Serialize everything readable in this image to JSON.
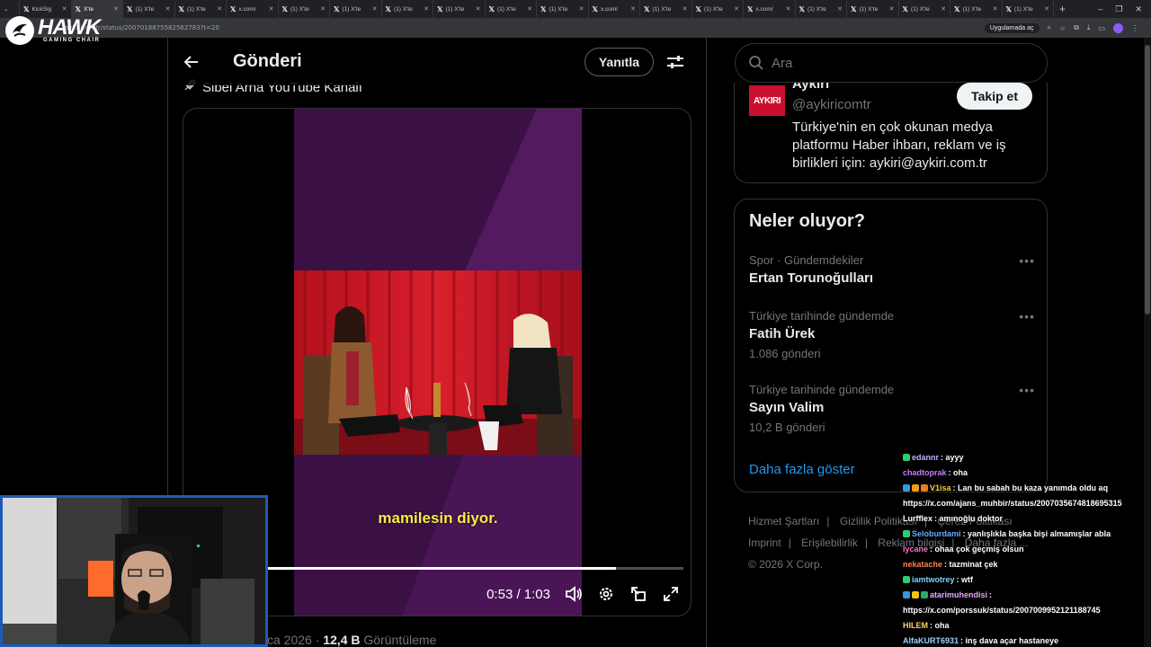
{
  "browser": {
    "tabs": [
      {
        "label": "KickSig",
        "active": false
      },
      {
        "label": "X'te",
        "active": true
      },
      {
        "label": "(1) X'te",
        "active": false
      },
      {
        "label": "(1) X'te",
        "active": false
      },
      {
        "label": "x.com/",
        "active": false
      },
      {
        "label": "(1) X'te",
        "active": false
      },
      {
        "label": "(1) X'te",
        "active": false
      },
      {
        "label": "(1) X'te",
        "active": false
      },
      {
        "label": "(1) X'te",
        "active": false
      },
      {
        "label": "(1) X'te",
        "active": false
      },
      {
        "label": "(1) X'te",
        "active": false
      },
      {
        "label": "x.com/",
        "active": false
      },
      {
        "label": "(1) X'te",
        "active": false
      },
      {
        "label": "(1) X'te",
        "active": false
      },
      {
        "label": "x.com/",
        "active": false
      },
      {
        "label": "(1) X'te",
        "active": false
      },
      {
        "label": "(1) X'te",
        "active": false
      },
      {
        "label": "(1) X'te",
        "active": false
      },
      {
        "label": "(1) X'te",
        "active": false
      },
      {
        "label": "(1) X'te",
        "active": false
      }
    ],
    "url": "aykiricomtr/status/2007018875582562783?t=20",
    "open_in_app": "Uygulamada aç"
  },
  "overlay": {
    "brand_name": "HAWK",
    "brand_sub": "GAMING CHAIR"
  },
  "post": {
    "header_title": "Gönderi",
    "reply_label": "Yanıtla",
    "source_line": "Sibel Arna YouTube Kanalı",
    "video": {
      "subtitle": "mamilesin diyor.",
      "time": "0:53 / 1:03",
      "progress": 0.84
    },
    "meta_date": "ca 2026",
    "meta_views": "12,4 B",
    "meta_views_label": "Görüntüleme"
  },
  "sidebar": {
    "search_placeholder": "Ara",
    "profile": {
      "name": "Aykırı",
      "handle": "@aykiricomtr",
      "avatar_text": "AYKIRI",
      "follow_label": "Takip et",
      "bio": "Türkiye'nin en çok okunan medya platformu Haber ihbarı, reklam ve iş birlikleri için: aykiri@aykiri.com.tr"
    },
    "trends_title": "Neler oluyor?",
    "trends": [
      {
        "context": "Spor · Gündemdekiler",
        "name": "Ertan Torunoğulları",
        "count": ""
      },
      {
        "context": "Türkiye tarihinde gündemde",
        "name": "Fatih Ürek",
        "count": "1.086 gönderi"
      },
      {
        "context": "Türkiye tarihinde gündemde",
        "name": "Sayın Valim",
        "count": "10,2 B gönderi"
      }
    ],
    "show_more": "Daha fazla göster",
    "footer": {
      "terms": "Hizmet Şartları",
      "privacy": "Gizlilik Politikası",
      "cookies": "Çerez Politikası",
      "imprint": "Imprint",
      "accessibility": "Erişilebilirlik",
      "ads": "Reklam bilgisi",
      "more": "Daha fazla ...",
      "copyright": "© 2026 X Corp."
    }
  },
  "chat": [
    {
      "user": "edannr",
      "color": "#b6b6ff",
      "text": "ayyy",
      "badges": [
        "#2ecc71"
      ]
    },
    {
      "user": "chadtoprak",
      "color": "#c77dff",
      "text": "oha",
      "badges": []
    },
    {
      "user": "V1isa",
      "color": "#f7d23e",
      "text": "Lan bu sabah bu kaza yanımda oldu aq https://x.com/ajans_muhbir/status/2007035674818695315",
      "badges": [
        "#3498db",
        "#f39c12",
        "#e67e22"
      ]
    },
    {
      "user": "Lurfflex",
      "color": "#ffffff",
      "text": "amınoğlu doktor",
      "badges": []
    },
    {
      "user": "Seloburdami",
      "color": "#6ea8ff",
      "text": "yanlışlıkla başka bişi almamışlar abla",
      "badges": [
        "#2ecc71"
      ]
    },
    {
      "user": "lycane",
      "color": "#ff6ec7",
      "text": "ohaa çok geçmiş olsun",
      "badges": []
    },
    {
      "user": "nekatache",
      "color": "#ff7f50",
      "text": "tazminat çek",
      "badges": []
    },
    {
      "user": "iamtwotrey",
      "color": "#7fd3ff",
      "text": "wtf",
      "badges": [
        "#2ecc71"
      ]
    },
    {
      "user": "atarimuhendisi",
      "color": "#e6a8ff",
      "text": "https://x.com/porssuk/status/2007009952121188745",
      "badges": [
        "#3498db",
        "#f1c40f",
        "#27ae60"
      ]
    },
    {
      "user": "HILEM",
      "color": "#ffd166",
      "text": "oha",
      "badges": []
    },
    {
      "user": "AlfaKURT6931",
      "color": "#9ad0ff",
      "text": "inş dava açar hastaneye",
      "badges": []
    }
  ]
}
